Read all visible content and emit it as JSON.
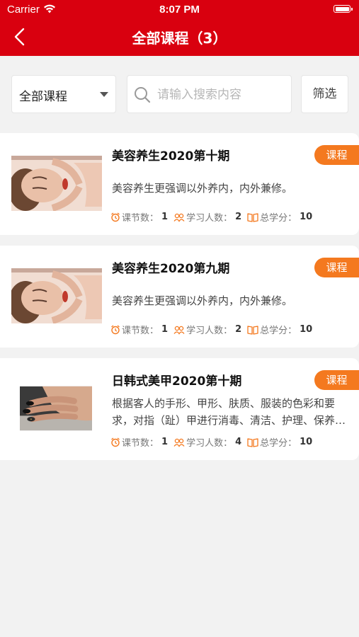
{
  "status_bar": {
    "carrier": "Carrier",
    "time": "8:07 PM"
  },
  "nav": {
    "title": "全部课程（3）"
  },
  "filters": {
    "category_selected": "全部课程",
    "search_placeholder": "请输入搜索内容",
    "filter_label": "筛选"
  },
  "stats_labels": {
    "lessons": "课节数：",
    "learners": "学习人数：",
    "credits": "总学分："
  },
  "courses": [
    {
      "title": "美容养生2020第十期",
      "tag": "课程",
      "description": "美容养生更强调以外养内，内外兼修。",
      "lessons": "1",
      "learners": "2",
      "credits": "10"
    },
    {
      "title": "美容养生2020第九期",
      "tag": "课程",
      "description": "美容养生更强调以外养内，内外兼修。",
      "lessons": "1",
      "learners": "2",
      "credits": "10"
    },
    {
      "title": "日韩式美甲2020第十期",
      "tag": "课程",
      "description": "根据客人的手形、甲形、肤质、服装的色彩和要求，对指（趾）甲进行消毒、清洁、护理、保养、修饰美化的过程。",
      "lessons": "1",
      "learners": "4",
      "credits": "10"
    }
  ],
  "colors": {
    "brand_red": "#d9000f",
    "tag_orange": "#f4791f",
    "background": "#f2f2f2"
  },
  "icons": [
    "wifi-icon",
    "battery-icon",
    "back-chevron-icon",
    "caret-down-icon",
    "search-icon",
    "alarm-clock-icon",
    "people-icon",
    "open-book-icon"
  ]
}
